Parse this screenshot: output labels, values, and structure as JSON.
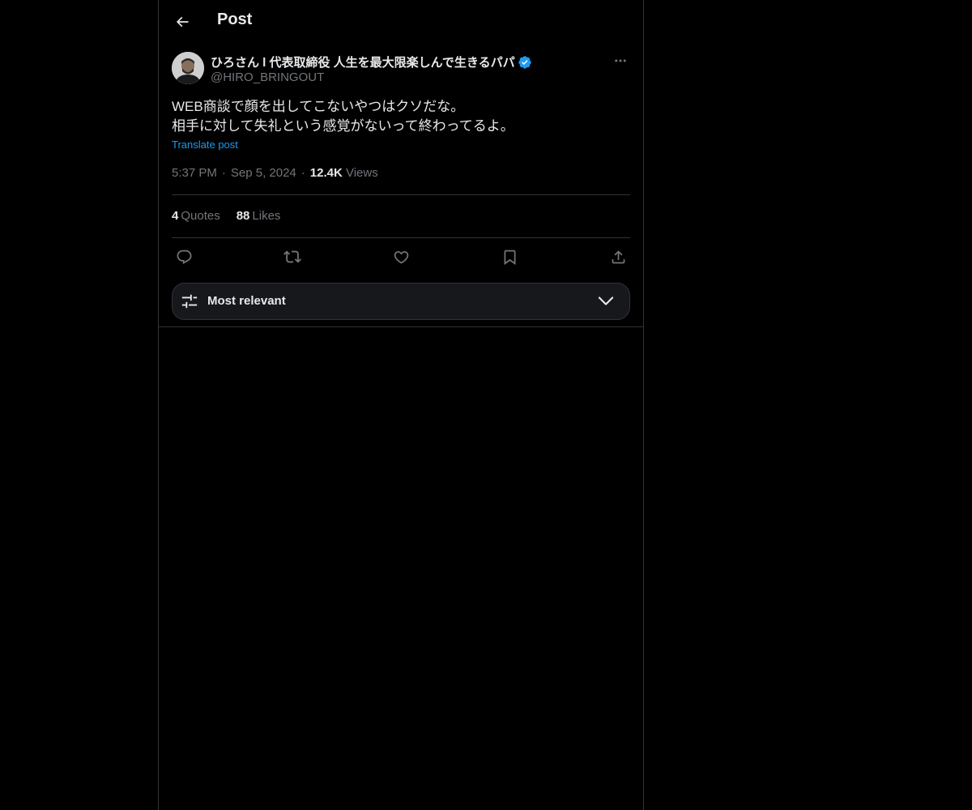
{
  "header": {
    "title": "Post",
    "back_icon": "arrow-left-icon"
  },
  "post": {
    "author": {
      "name": "ひろさん l 代表取締役 人生を最大限楽しんで生きるパパ",
      "handle": "@HIRO_BRINGOUT",
      "verified": true,
      "verified_color": "#1d9bf0"
    },
    "text_lines": [
      "WEB商談で顔を出してこないやつはクソだな。",
      "相手に対して失礼という感覚がないって終わってるよ。"
    ],
    "translate_label": "Translate post",
    "time": "5:37 PM",
    "date": "Sep 5, 2024",
    "views_count": "12.4K",
    "views_label": "Views",
    "quotes_count": "4",
    "quotes_label": "Quotes",
    "likes_count": "88",
    "likes_label": "Likes"
  },
  "actions": [
    "reply-icon",
    "repost-icon",
    "like-icon",
    "bookmark-icon",
    "share-icon"
  ],
  "sort": {
    "label": "Most relevant",
    "icon": "sliders-icon"
  },
  "colors": {
    "background": "#000000",
    "text": "#e7e9ea",
    "muted": "#71767b",
    "accent": "#1d9bf0",
    "border": "#2f3336"
  }
}
